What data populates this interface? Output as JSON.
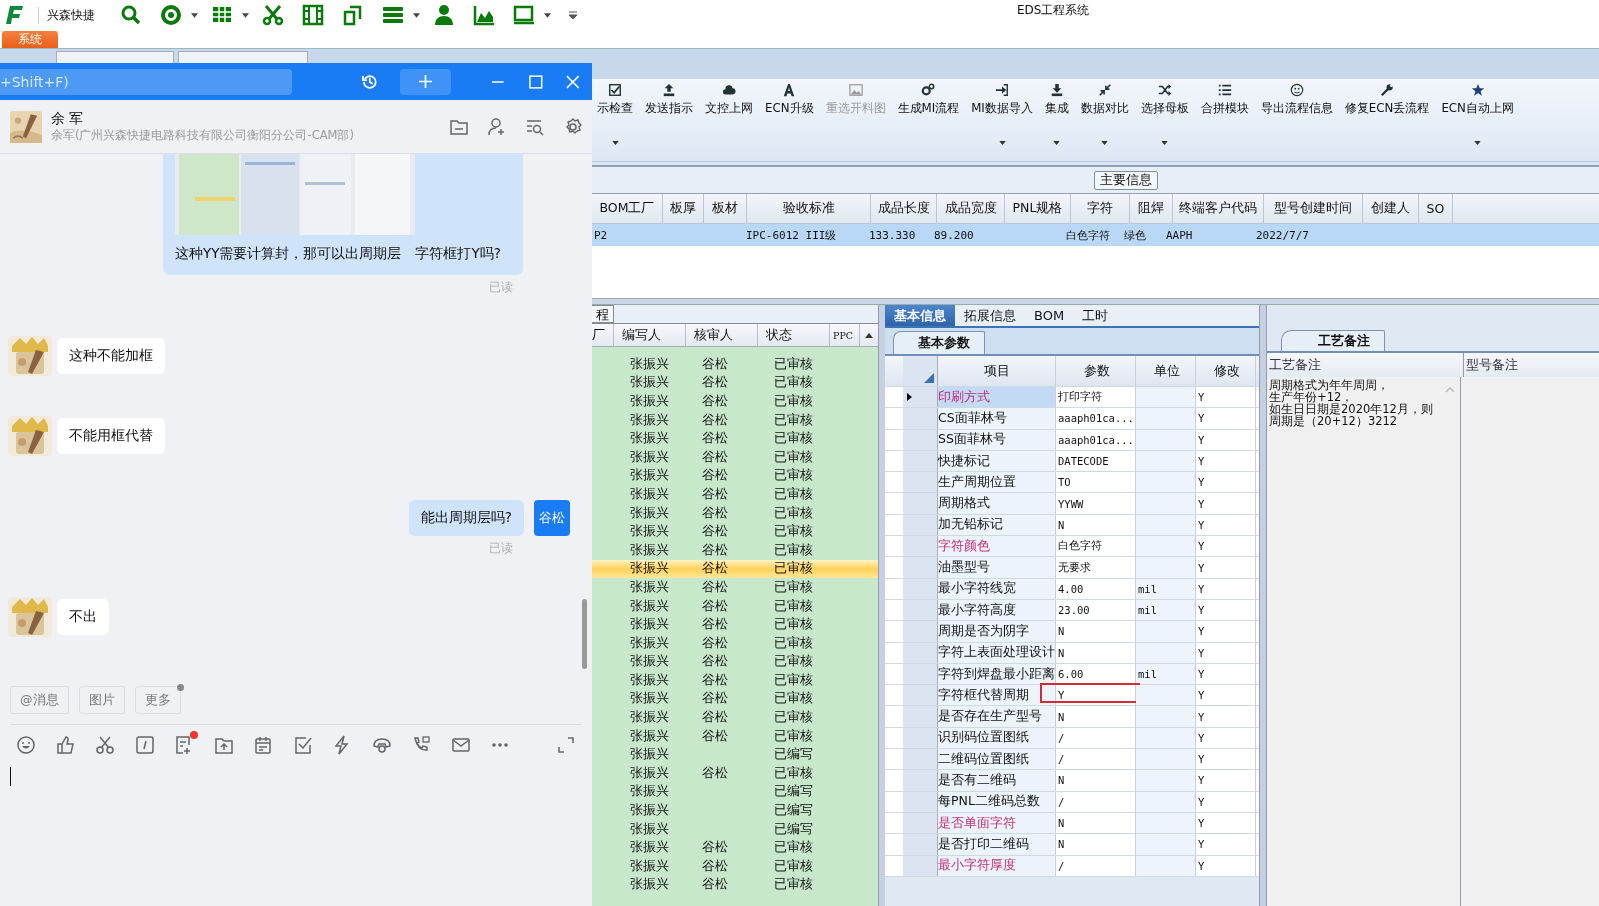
{
  "app": {
    "name": "兴森快捷",
    "title": "EDS工程系统",
    "menu_tab": "系统"
  },
  "chat": {
    "search_placeholder": "+Shift+F)",
    "contact": {
      "name": "余 军",
      "org": "余军(广州兴森快捷电路科技有限公司衡阳分公司-CAM部)"
    },
    "messages": [
      {
        "kind": "image_text",
        "incoming": false,
        "text": "这种YY需要计算封，那可以出周期层　字符框打Y吗?",
        "receipt": "已读"
      },
      {
        "kind": "text",
        "incoming": true,
        "text": "这种不能加框"
      },
      {
        "kind": "text",
        "incoming": true,
        "text": "不能用框代替"
      },
      {
        "kind": "text",
        "incoming": false,
        "text": "能出周期层吗?",
        "avatar_text": "谷松",
        "receipt": "已读"
      },
      {
        "kind": "text",
        "incoming": true,
        "text": "不出"
      }
    ],
    "quick_actions": [
      {
        "label": "@消息",
        "badge": false
      },
      {
        "label": "图片",
        "badge": false
      },
      {
        "label": "更多",
        "badge": true
      }
    ],
    "tools": [
      {
        "badge": false
      },
      {
        "badge": false
      },
      {
        "badge": false
      },
      {
        "badge": false
      },
      {
        "badge": true
      },
      {
        "badge": false
      },
      {
        "badge": false
      },
      {
        "badge": false
      },
      {
        "badge": false
      },
      {
        "badge": false
      },
      {
        "badge": false
      },
      {
        "badge": false
      },
      {
        "badge": false
      }
    ]
  },
  "toolbar": [
    {
      "label": "示检查",
      "dropdown": true,
      "disabled": false
    },
    {
      "label": "发送指示",
      "dropdown": false,
      "disabled": false
    },
    {
      "label": "文控上网",
      "dropdown": false,
      "disabled": false
    },
    {
      "label": "ECN升级",
      "dropdown": false,
      "disabled": false
    },
    {
      "label": "重选开料图",
      "dropdown": false,
      "disabled": true
    },
    {
      "label": "生成MI流程",
      "dropdown": false,
      "disabled": false
    },
    {
      "label": "MI数据导入",
      "dropdown": true,
      "disabled": false
    },
    {
      "label": "集成",
      "dropdown": true,
      "disabled": false
    },
    {
      "label": "数据对比",
      "dropdown": true,
      "disabled": false
    },
    {
      "label": "选择母板",
      "dropdown": true,
      "disabled": false
    },
    {
      "label": "合拼模块",
      "dropdown": false,
      "disabled": false
    },
    {
      "label": "导出流程信息",
      "dropdown": false,
      "disabled": false
    },
    {
      "label": "修复ECN丢流程",
      "dropdown": false,
      "disabled": false
    },
    {
      "label": "ECN自动上网",
      "dropdown": true,
      "disabled": false
    }
  ],
  "main_info": {
    "label": "主要信息",
    "columns": [
      "BOM工厂",
      "板厚",
      "板材",
      "验收标准",
      "成品长度",
      "成品宽度",
      "PNL规格",
      "字符",
      "阻焊",
      "终端客户代码",
      "型号创建时间",
      "创建人",
      "SO"
    ],
    "rows": [
      [
        "P2",
        "",
        "",
        "IPC-6012 III级",
        "133.330",
        "89.200",
        "",
        "白色字符",
        "绿色",
        "AAPH",
        "2022/7/7",
        "",
        ""
      ]
    ]
  },
  "flow_list": {
    "tab": "程",
    "columns": [
      "厂",
      "编写人",
      "核审人",
      "状态",
      "PPC"
    ],
    "rows": [
      {
        "writer": "张振兴",
        "reviewer": "谷松",
        "status": "已审核",
        "selected": false
      },
      {
        "writer": "张振兴",
        "reviewer": "谷松",
        "status": "已审核",
        "selected": false
      },
      {
        "writer": "张振兴",
        "reviewer": "谷松",
        "status": "已审核",
        "selected": false
      },
      {
        "writer": "张振兴",
        "reviewer": "谷松",
        "status": "已审核",
        "selected": false
      },
      {
        "writer": "张振兴",
        "reviewer": "谷松",
        "status": "已审核",
        "selected": false
      },
      {
        "writer": "张振兴",
        "reviewer": "谷松",
        "status": "已审核",
        "selected": false
      },
      {
        "writer": "张振兴",
        "reviewer": "谷松",
        "status": "已审核",
        "selected": false
      },
      {
        "writer": "张振兴",
        "reviewer": "谷松",
        "status": "已审核",
        "selected": false
      },
      {
        "writer": "张振兴",
        "reviewer": "谷松",
        "status": "已审核",
        "selected": false
      },
      {
        "writer": "张振兴",
        "reviewer": "谷松",
        "status": "已审核",
        "selected": false
      },
      {
        "writer": "张振兴",
        "reviewer": "谷松",
        "status": "已审核",
        "selected": false
      },
      {
        "writer": "张振兴",
        "reviewer": "谷松",
        "status": "已审核",
        "selected": true
      },
      {
        "writer": "张振兴",
        "reviewer": "谷松",
        "status": "已审核",
        "selected": false
      },
      {
        "writer": "张振兴",
        "reviewer": "谷松",
        "status": "已审核",
        "selected": false
      },
      {
        "writer": "张振兴",
        "reviewer": "谷松",
        "status": "已审核",
        "selected": false
      },
      {
        "writer": "张振兴",
        "reviewer": "谷松",
        "status": "已审核",
        "selected": false
      },
      {
        "writer": "张振兴",
        "reviewer": "谷松",
        "status": "已审核",
        "selected": false
      },
      {
        "writer": "张振兴",
        "reviewer": "谷松",
        "status": "已审核",
        "selected": false
      },
      {
        "writer": "张振兴",
        "reviewer": "谷松",
        "status": "已审核",
        "selected": false
      },
      {
        "writer": "张振兴",
        "reviewer": "谷松",
        "status": "已审核",
        "selected": false
      },
      {
        "writer": "张振兴",
        "reviewer": "谷松",
        "status": "已审核",
        "selected": false
      },
      {
        "writer": "张振兴",
        "reviewer": "",
        "status": "已编写",
        "selected": false
      },
      {
        "writer": "张振兴",
        "reviewer": "谷松",
        "status": "已审核",
        "selected": false
      },
      {
        "writer": "张振兴",
        "reviewer": "",
        "status": "已编写",
        "selected": false
      },
      {
        "writer": "张振兴",
        "reviewer": "",
        "status": "已编写",
        "selected": false
      },
      {
        "writer": "张振兴",
        "reviewer": "",
        "status": "已编写",
        "selected": false
      },
      {
        "writer": "张振兴",
        "reviewer": "谷松",
        "status": "已审核",
        "selected": false
      },
      {
        "writer": "张振兴",
        "reviewer": "谷松",
        "status": "已审核",
        "selected": false
      },
      {
        "writer": "张振兴",
        "reviewer": "谷松",
        "status": "已审核",
        "selected": false
      }
    ]
  },
  "params": {
    "tabs": [
      {
        "label": "基本信息",
        "selected": true
      },
      {
        "label": "拓展信息",
        "selected": false
      },
      {
        "label": "BOM",
        "selected": false
      },
      {
        "label": "工时",
        "selected": false
      }
    ],
    "subtab": "基本参数",
    "columns": [
      "项目",
      "参数",
      "单位",
      "修改"
    ],
    "rows": [
      {
        "item": "印刷方式",
        "value": "打印字符",
        "unit": "",
        "modified": "Y",
        "emphasized": true,
        "current": true,
        "marked": false
      },
      {
        "item": "CS面菲林号",
        "value": "aaaph01ca...",
        "unit": "",
        "modified": "Y",
        "emphasized": false,
        "current": false,
        "marked": false
      },
      {
        "item": "SS面菲林号",
        "value": "aaaph01ca...",
        "unit": "",
        "modified": "Y",
        "emphasized": false,
        "current": false,
        "marked": false
      },
      {
        "item": "快捷标记",
        "value": "DATECODE",
        "unit": "",
        "modified": "Y",
        "emphasized": false,
        "current": false,
        "marked": false
      },
      {
        "item": "生产周期位置",
        "value": "TO",
        "unit": "",
        "modified": "Y",
        "emphasized": false,
        "current": false,
        "marked": false
      },
      {
        "item": "周期格式",
        "value": "YYWW",
        "unit": "",
        "modified": "Y",
        "emphasized": false,
        "current": false,
        "marked": false
      },
      {
        "item": "加无铅标记",
        "value": "N",
        "unit": "",
        "modified": "Y",
        "emphasized": false,
        "current": false,
        "marked": false
      },
      {
        "item": "字符颜色",
        "value": "白色字符",
        "unit": "",
        "modified": "Y",
        "emphasized": true,
        "current": false,
        "marked": false
      },
      {
        "item": "油墨型号",
        "value": "无要求",
        "unit": "",
        "modified": "Y",
        "emphasized": false,
        "current": false,
        "marked": false
      },
      {
        "item": "最小字符线宽",
        "value": "4.00",
        "unit": "mil",
        "modified": "Y",
        "emphasized": false,
        "current": false,
        "marked": false
      },
      {
        "item": "最小字符高度",
        "value": "23.00",
        "unit": "mil",
        "modified": "Y",
        "emphasized": false,
        "current": false,
        "marked": false
      },
      {
        "item": "周期是否为阴字",
        "value": "N",
        "unit": "",
        "modified": "Y",
        "emphasized": false,
        "current": false,
        "marked": false
      },
      {
        "item": "字符上表面处理设计",
        "value": "N",
        "unit": "",
        "modified": "Y",
        "emphasized": false,
        "current": false,
        "marked": false
      },
      {
        "item": "字符到焊盘最小距离",
        "value": "6.00",
        "unit": "mil",
        "modified": "Y",
        "emphasized": false,
        "current": false,
        "marked": false
      },
      {
        "item": "字符框代替周期",
        "value": "Y",
        "unit": "",
        "modified": "Y",
        "emphasized": false,
        "current": false,
        "marked": true
      },
      {
        "item": "是否存在生产型号",
        "value": "N",
        "unit": "",
        "modified": "Y",
        "emphasized": false,
        "current": false,
        "marked": false
      },
      {
        "item": "识别码位置图纸",
        "value": "/",
        "unit": "",
        "modified": "Y",
        "emphasized": false,
        "current": false,
        "marked": false
      },
      {
        "item": "二维码位置图纸",
        "value": "/",
        "unit": "",
        "modified": "Y",
        "emphasized": false,
        "current": false,
        "marked": false
      },
      {
        "item": "是否有二维码",
        "value": "N",
        "unit": "",
        "modified": "Y",
        "emphasized": false,
        "current": false,
        "marked": false
      },
      {
        "item": "每PNL二维码总数",
        "value": "/",
        "unit": "",
        "modified": "Y",
        "emphasized": false,
        "current": false,
        "marked": false
      },
      {
        "item": "是否单面字符",
        "value": "N",
        "unit": "",
        "modified": "Y",
        "emphasized": true,
        "current": false,
        "marked": false
      },
      {
        "item": "是否打印二维码",
        "value": "N",
        "unit": "",
        "modified": "Y",
        "emphasized": false,
        "current": false,
        "marked": false
      },
      {
        "item": "最小字符厚度",
        "value": "/",
        "unit": "",
        "modified": "Y",
        "emphasized": true,
        "current": false,
        "marked": false
      }
    ]
  },
  "remarks": {
    "tab": "工艺备注",
    "columns": [
      "工艺备注",
      "型号备注"
    ],
    "process_note": [
      "周期格式为年年周周，",
      "生产年份+12，",
      "如生日日期是2020年12月，则周期是（20+12）3212"
    ]
  }
}
